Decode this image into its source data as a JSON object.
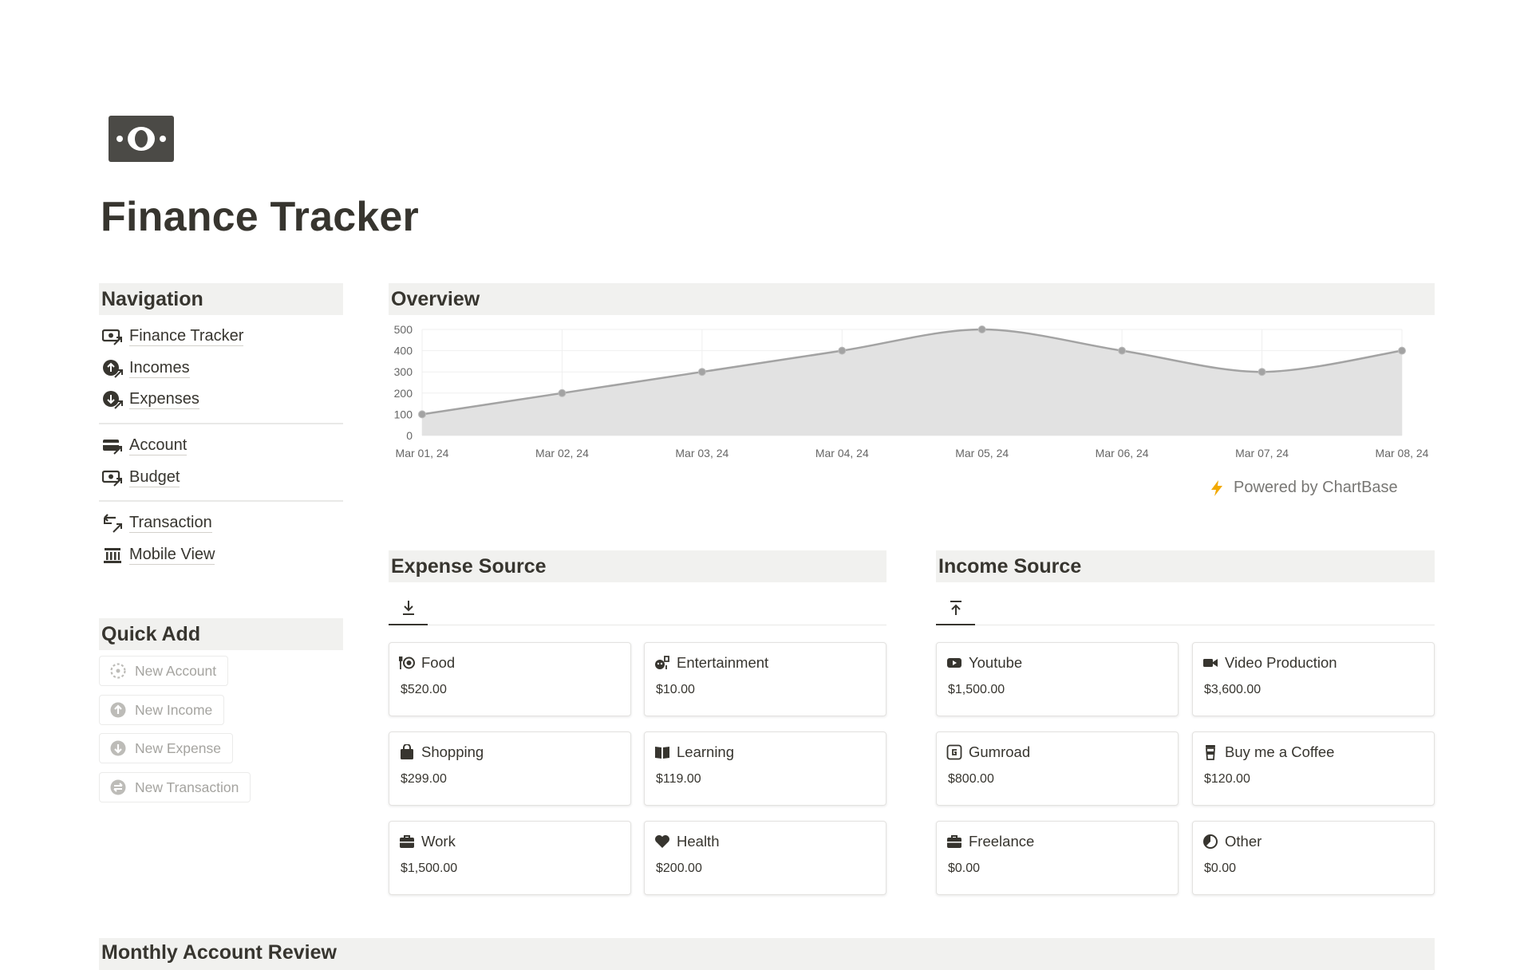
{
  "page": {
    "title": "Finance Tracker",
    "icon": "banknote-icon"
  },
  "navigation": {
    "heading": "Navigation",
    "groups": [
      [
        {
          "label": "Finance Tracker",
          "icon": "banknote-link-icon"
        },
        {
          "label": "Incomes",
          "icon": "income-link-icon"
        },
        {
          "label": "Expenses",
          "icon": "expense-link-icon"
        }
      ],
      [
        {
          "label": "Account",
          "icon": "card-link-icon"
        },
        {
          "label": "Budget",
          "icon": "budget-link-icon"
        }
      ],
      [
        {
          "label": "Transaction",
          "icon": "transfer-link-icon"
        },
        {
          "label": "Mobile View",
          "icon": "bank-icon"
        }
      ]
    ]
  },
  "quick_add": {
    "heading": "Quick Add",
    "buttons": [
      {
        "label": "New Account",
        "icon": "dashed-circle-icon"
      },
      {
        "label": "New Income",
        "icon": "arrow-up-circle-icon"
      },
      {
        "label": "New Expense",
        "icon": "arrow-down-circle-icon"
      },
      {
        "label": "New Transaction",
        "icon": "transfer-circle-icon"
      }
    ]
  },
  "overview": {
    "heading": "Overview",
    "powered_by": "Powered by ChartBase",
    "powered_icon": "lightning-icon",
    "accent": "#f2a900"
  },
  "chart_data": {
    "type": "area",
    "x": [
      "Mar 01, 24",
      "Mar 02, 24",
      "Mar 03, 24",
      "Mar 04, 24",
      "Mar 05, 24",
      "Mar 06, 24",
      "Mar 07, 24",
      "Mar 08, 24"
    ],
    "series": [
      {
        "values": [
          100,
          200,
          300,
          400,
          500,
          400,
          300,
          400
        ]
      }
    ],
    "yticks": [
      0,
      100,
      200,
      300,
      400,
      500
    ],
    "ylim": [
      0,
      500
    ],
    "grid": true,
    "line_color": "#a3a3a3",
    "fill_color": "#e2e2e2"
  },
  "expense_source": {
    "heading": "Expense Source",
    "tab_icon": "download-icon",
    "cards": [
      {
        "label": "Food",
        "value": "$520.00",
        "icon": "utensils-icon"
      },
      {
        "label": "Entertainment",
        "value": "$10.00",
        "icon": "drama-icon"
      },
      {
        "label": "Shopping",
        "value": "$299.00",
        "icon": "shopping-bag-icon"
      },
      {
        "label": "Learning",
        "value": "$119.00",
        "icon": "book-icon"
      },
      {
        "label": "Work",
        "value": "$1,500.00",
        "icon": "briefcase-icon"
      },
      {
        "label": "Health",
        "value": "$200.00",
        "icon": "heart-icon"
      }
    ]
  },
  "income_source": {
    "heading": "Income Source",
    "tab_icon": "upload-icon",
    "cards": [
      {
        "label": "Youtube",
        "value": "$1,500.00",
        "icon": "play-icon"
      },
      {
        "label": "Video Production",
        "value": "$3,600.00",
        "icon": "video-camera-icon"
      },
      {
        "label": "Gumroad",
        "value": "$800.00",
        "icon": "gumroad-icon"
      },
      {
        "label": "Buy me a Coffee",
        "value": "$120.00",
        "icon": "coffee-cup-icon"
      },
      {
        "label": "Freelance",
        "value": "$0.00",
        "icon": "briefcase-icon"
      },
      {
        "label": "Other",
        "value": "$0.00",
        "icon": "pie-icon"
      }
    ]
  },
  "monthly_review": {
    "heading": "Monthly Account Review"
  }
}
